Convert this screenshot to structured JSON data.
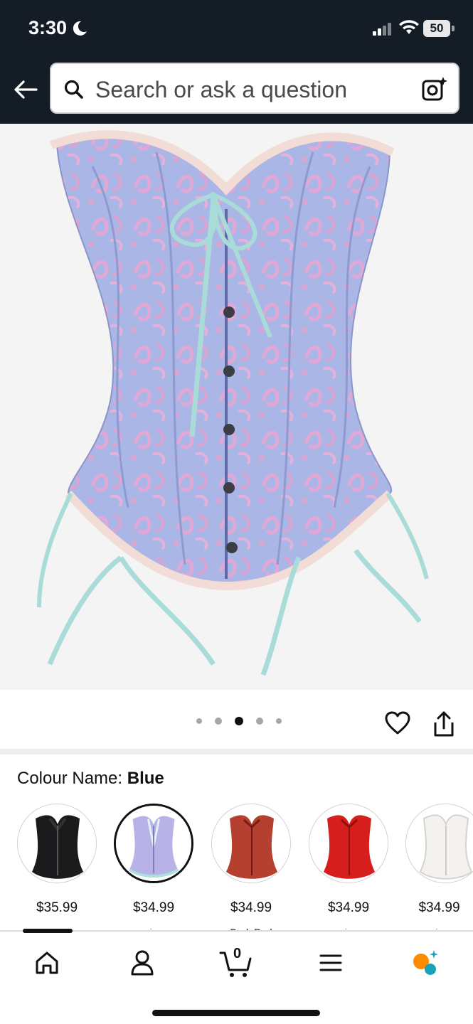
{
  "status": {
    "time": "3:30",
    "battery": "50"
  },
  "search": {
    "placeholder": "Search or ask a question"
  },
  "carousel": {
    "dots": 5,
    "active_index": 2
  },
  "colour": {
    "label": "Colour Name:",
    "value": "Blue"
  },
  "swatches": [
    {
      "color": "black",
      "price": "$35.99",
      "sub": "prime",
      "selected": false
    },
    {
      "color": "lavender",
      "price": "$34.99",
      "sub": "prime",
      "selected": true
    },
    {
      "color": "dark-red",
      "price": "$34.99",
      "sub": "Dark Red",
      "selected": false
    },
    {
      "color": "red",
      "price": "$34.99",
      "sub": "prime",
      "selected": false
    },
    {
      "color": "white",
      "price": "$34.99",
      "sub": "prime",
      "selected": false
    }
  ],
  "nav": {
    "cart_count": "0"
  },
  "colors": {
    "header_bg": "#141c26",
    "accent_orange": "#ff8a00",
    "accent_teal": "#1aa3b8"
  }
}
